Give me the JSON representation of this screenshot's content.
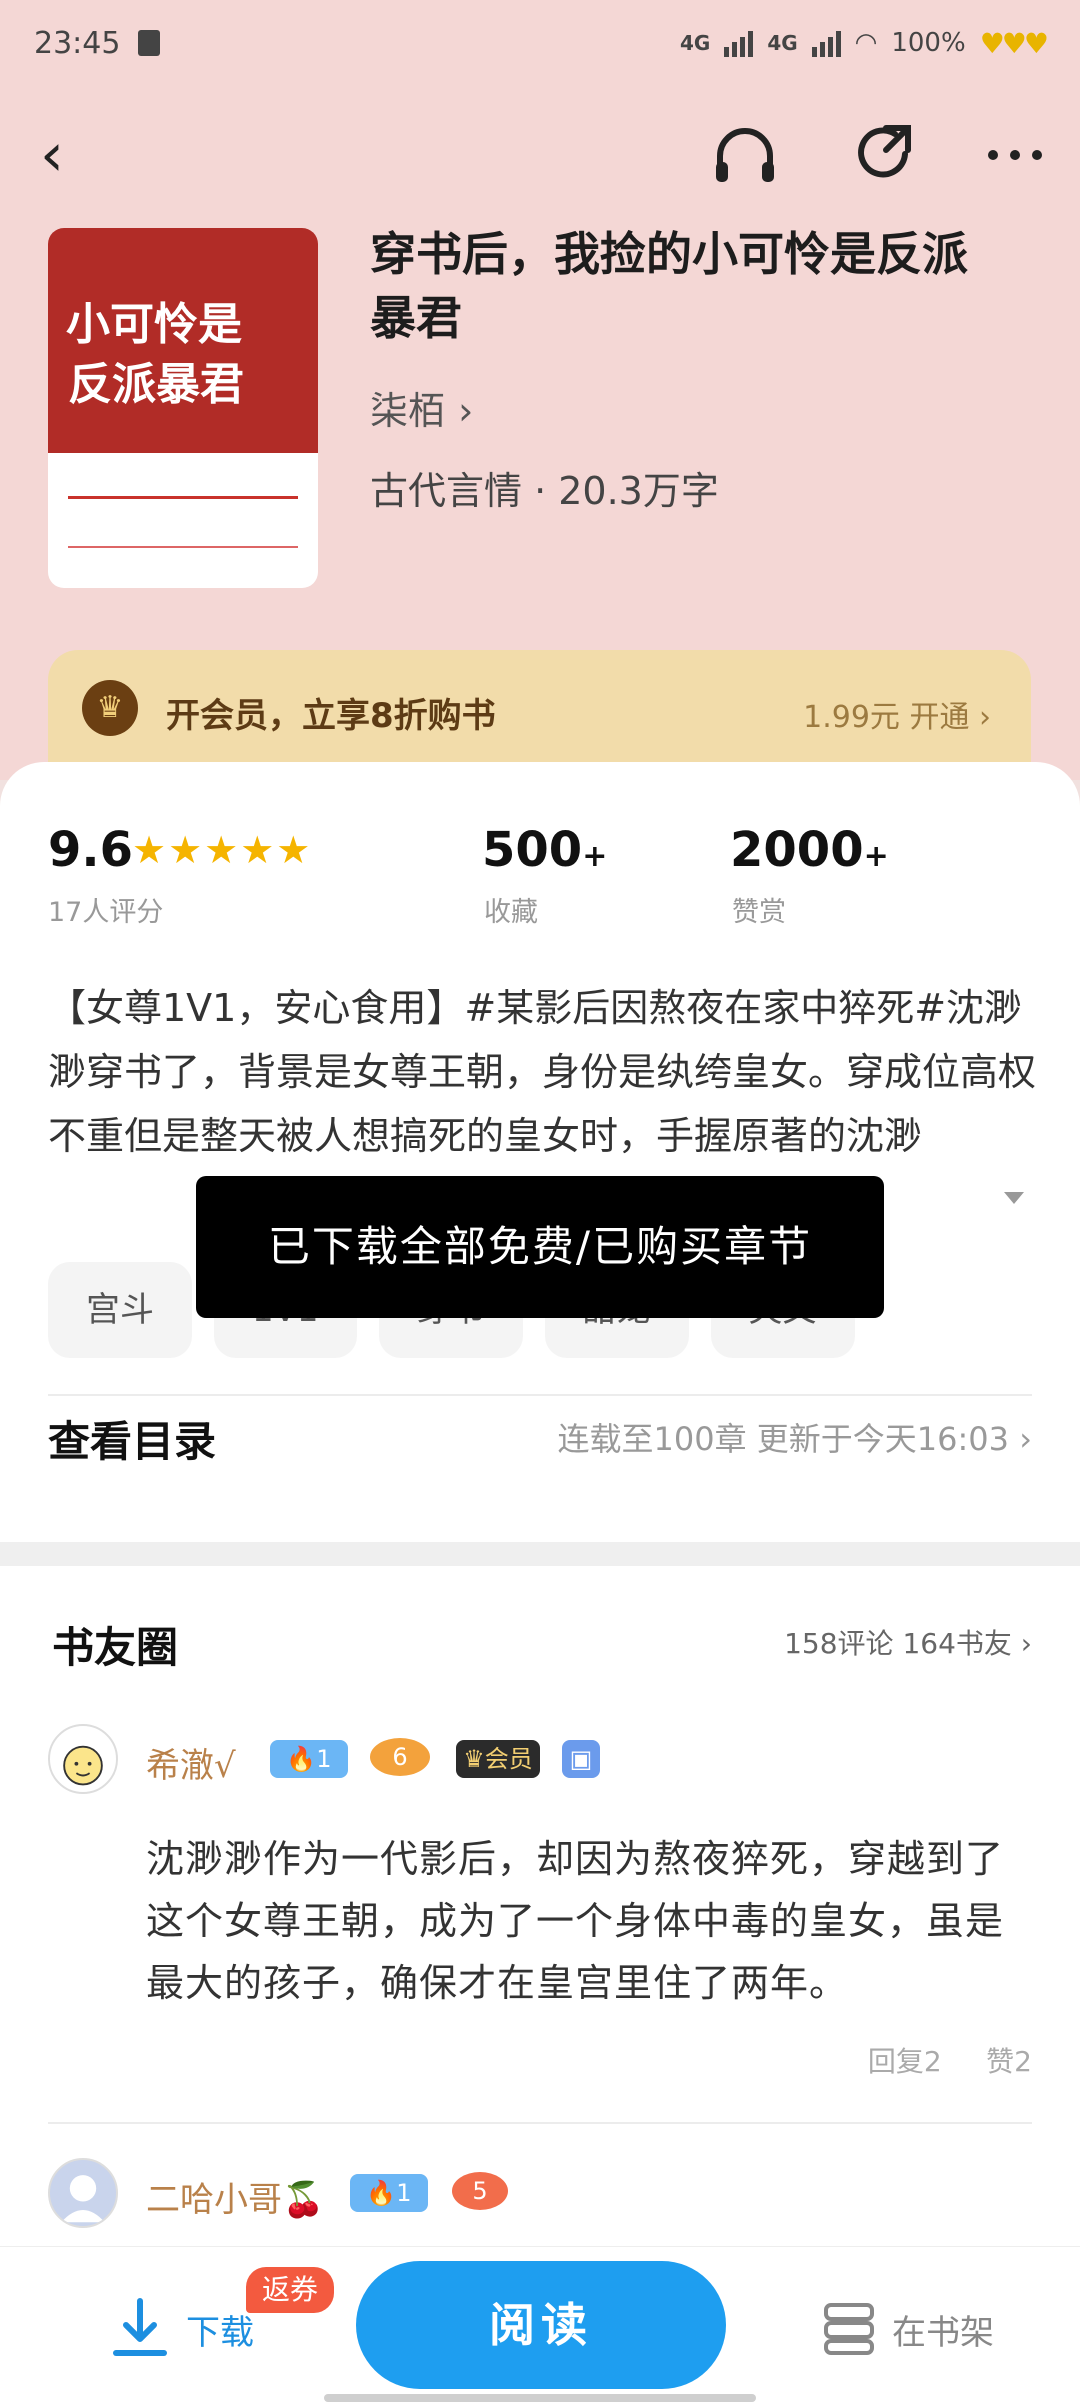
{
  "status_bar": {
    "time": "23:45",
    "net1": "4G",
    "net2": "4G",
    "battery": "100%"
  },
  "book": {
    "title": "穿书后，我捡的小可怜是反派暴君",
    "author": "柒栢",
    "meta": "古代言情 · 20.3万字",
    "cover_line1": "小可怜是",
    "cover_line2": "反派暴君"
  },
  "vip": {
    "text": "开会员，立享8折购书",
    "price": "1.99元 开通"
  },
  "stats": {
    "score": "9.6",
    "score_sub": "17人评分",
    "fav": "500",
    "fav_plus": "+",
    "fav_sub": "收藏",
    "like": "2000",
    "like_plus": "+",
    "like_sub": "赞赏"
  },
  "description": "【女尊1V1，安心食用】#某影后因熬夜在家中猝死#沈渺渺穿书了，背景是女尊王朝，身份是纨绔皇女。穿成位高权不重但是整天被人想搞死的皇女时，手握原著的沈渺",
  "tags": [
    "宫斗",
    "1V1",
    "穿书",
    "甜宠",
    "爽文"
  ],
  "toast": "已下载全部免费/已购买章节",
  "toc": {
    "label": "查看目录",
    "info": "连载至100章   更新于今天16:03"
  },
  "circle": {
    "title": "书友圈",
    "summary": "158评论 164书友",
    "comments": [
      {
        "user": "希澈√",
        "level": "1",
        "vip": "会员",
        "text": "沈渺渺作为一代影后，却因为熬夜猝死，穿越到了这个女尊王朝，成为了一个身体中毒的皇女，虽是最大的孩子，确保才在皇宫里住了两年。",
        "reply": "回复2",
        "like": "赞2"
      },
      {
        "user": "二哈小哥🍒",
        "level": "1"
      }
    ]
  },
  "bottom": {
    "download": "下载",
    "coupon": "返券",
    "read": "阅读",
    "shelf": "在书架"
  },
  "colors": {
    "accent": "#1e9ef0",
    "header_bg": "#f4d7d5",
    "vip_bg": "#f2dcaa"
  }
}
